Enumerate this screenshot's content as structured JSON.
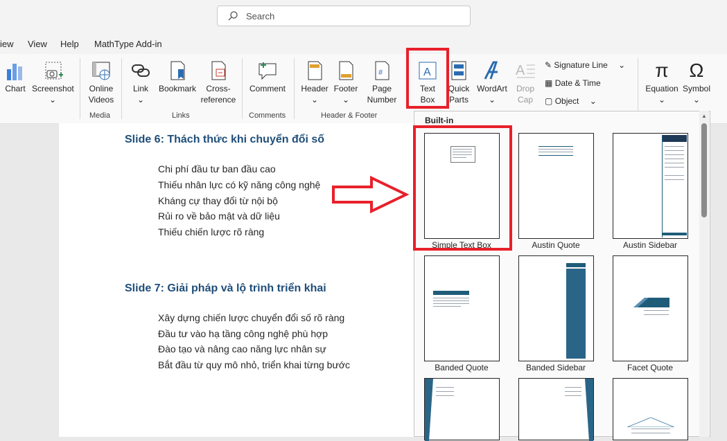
{
  "search": {
    "placeholder": "Search"
  },
  "menu": [
    "iew",
    "View",
    "Help",
    "MathType Add-in"
  ],
  "ribbon": {
    "chart": "Chart",
    "screenshot": "Screenshot",
    "online_videos": [
      "Online",
      "Videos"
    ],
    "link": "Link",
    "bookmark": "Bookmark",
    "cross_reference": [
      "Cross-",
      "reference"
    ],
    "comment": "Comment",
    "header": "Header",
    "footer": "Footer",
    "page_number": [
      "Page",
      "Number"
    ],
    "text_box": [
      "Text",
      "Box"
    ],
    "quick_parts": [
      "Quick",
      "Parts"
    ],
    "wordart": "WordArt",
    "drop_cap": [
      "Drop",
      "Cap"
    ],
    "signature_line": "Signature Line",
    "date_time": "Date & Time",
    "object": "Object",
    "equation": "Equation",
    "symbol": "Symbol",
    "groups": {
      "media": "Media",
      "links": "Links",
      "comments": "Comments",
      "header_footer": "Header & Footer"
    }
  },
  "document": {
    "slide6_title": "Slide 6: Thách thức khi chuyển đổi số",
    "slide6_items": [
      "Chi phí đầu tư ban đầu cao",
      "Thiếu nhân lực có kỹ năng công nghệ",
      "Kháng cự thay đổi từ nội bộ",
      "Rủi ro về bảo mật và dữ liệu",
      "Thiếu chiến lược rõ ràng"
    ],
    "slide7_title": "Slide 7: Giải pháp và lộ trình triển khai",
    "slide7_items": [
      "Xây dựng chiến lược chuyển đổi số rõ ràng",
      "Đầu tư vào hạ tầng công nghệ phù hợp",
      "Đào tạo và nâng cao năng lực nhân sự",
      "Bắt đầu từ quy mô nhỏ, triển khai từng bước"
    ]
  },
  "gallery": {
    "section": "Built-in",
    "items": [
      "Simple Text Box",
      "Austin Quote",
      "Austin Sidebar",
      "Banded Quote",
      "Banded Sidebar",
      "Facet Quote"
    ]
  },
  "colors": {
    "highlight": "#e8202a",
    "arrow": "#e8202a",
    "heading": "#1f4e79",
    "accent": "#1f5c7a"
  }
}
